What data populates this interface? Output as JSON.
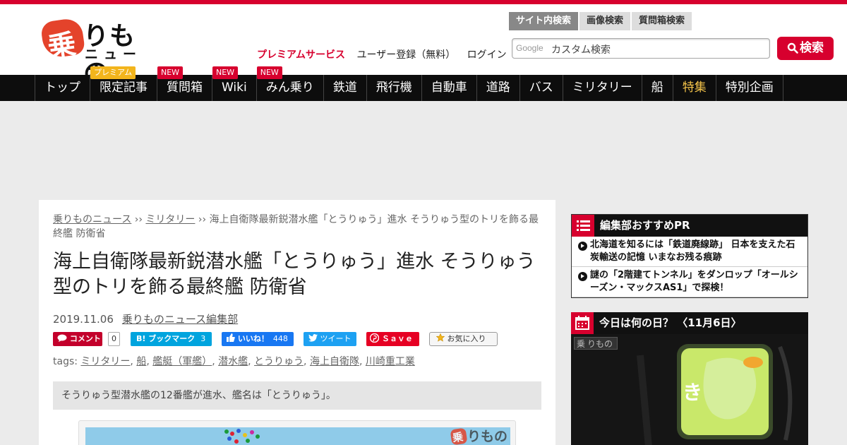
{
  "logo": {
    "kanji": "乗",
    "kana": "りもの",
    "sub": "ニュース",
    "photo_watermark_kana": "りもの"
  },
  "header": {
    "links": [
      {
        "label": "プレミアムサービス",
        "premium": true
      },
      {
        "label": "ユーザー登録（無料）",
        "premium": false
      },
      {
        "label": "ログイン",
        "premium": false
      }
    ]
  },
  "search": {
    "tabs": [
      "サイト内検索",
      "画像検索",
      "質問箱検索"
    ],
    "active_tab": 0,
    "google_label": "Google",
    "placeholder": "カスタム検索",
    "button_label": "検索"
  },
  "nav": {
    "items": [
      {
        "label": "トップ",
        "badge": ""
      },
      {
        "label": "限定記事",
        "badge": "プレミアム"
      },
      {
        "label": "質問箱",
        "badge": "NEW"
      },
      {
        "label": "Wiki",
        "badge": "NEW"
      },
      {
        "label": "みん乗り",
        "badge": "NEW"
      },
      {
        "label": "鉄道",
        "badge": ""
      },
      {
        "label": "飛行機",
        "badge": ""
      },
      {
        "label": "自動車",
        "badge": ""
      },
      {
        "label": "道路",
        "badge": ""
      },
      {
        "label": "バス",
        "badge": ""
      },
      {
        "label": "ミリタリー",
        "badge": ""
      },
      {
        "label": "船",
        "badge": ""
      },
      {
        "label": "特集",
        "badge": "",
        "highlight": true
      },
      {
        "label": "特別企画",
        "badge": ""
      }
    ]
  },
  "article": {
    "breadcrumb": [
      "乗りものニュース",
      "ミリタリー",
      "海上自衛隊最新鋭潜水艦「とうりゅう」進水 そうりゅう型のトリを飾る最終艦 防衛省"
    ],
    "breadcrumb_sep": " ›› ",
    "title": "海上自衛隊最新鋭潜水艦「とうりゅう」進水 そうりゅう型のトリを飾る最終艦 防衛省",
    "date": "2019.11.06",
    "author": "乗りものニュース編集部",
    "social": {
      "comment_label": "コメント",
      "comment_count": "0",
      "bookmark_label": "B! ブックマーク",
      "bookmark_count": "3",
      "like_label": "いいね！",
      "like_count": "448",
      "tweet_label": "ツイート",
      "save_label": "Ｓａｖｅ",
      "favorite_label": "お気に入り"
    },
    "tags_label": "tags:",
    "tags": [
      "ミリタリー",
      "船",
      "艦艇（軍艦）",
      "潜水艦",
      "とうりゅう",
      "海上自衛隊",
      "川崎重工業"
    ],
    "lead": "そうりゅう型潜水艦の12番艦が進水、艦名は「とうりゅう」。"
  },
  "sidebar": {
    "pr": {
      "heading": "編集部おすすめPR",
      "items": [
        "北海道を知るには「鉄道廃線跡」 日本を支えた石炭輸送の記憶 いまなお残る痕跡",
        "謎の「2階建てトンネル」をダンロップ「オールシーズン・マックスAS1」で探検！"
      ]
    },
    "today": {
      "heading": "今日は何の日？ 〈11月6日〉"
    }
  },
  "colors": {
    "brand_red": "#d7002e",
    "nav_bg": "#0d0d0d",
    "premium_badge": "#f3b51c",
    "twitter": "#1da1f2",
    "facebook": "#1877f2",
    "hatena": "#00a4de",
    "pinterest": "#e60023"
  }
}
